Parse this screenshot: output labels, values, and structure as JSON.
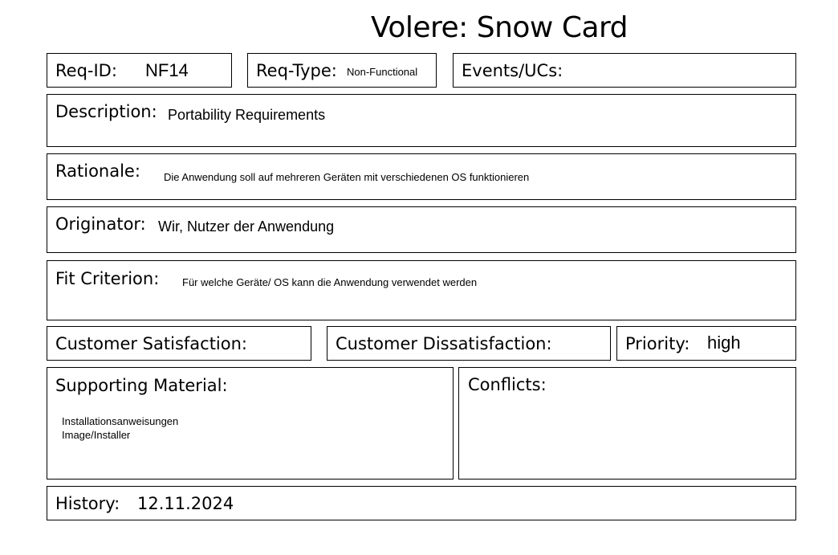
{
  "title": "Volere: Snow Card",
  "req_id": {
    "label": "Req-ID:",
    "value": "NF14"
  },
  "req_type": {
    "label": "Req-Type:",
    "value": "Non-Functional"
  },
  "events": {
    "label": "Events/UCs:",
    "value": ""
  },
  "description": {
    "label": "Description:",
    "value": "Portability Requirements"
  },
  "rationale": {
    "label": "Rationale:",
    "value": "Die Anwendung soll auf mehreren Geräten mit verschiedenen OS funktionieren"
  },
  "originator": {
    "label": "Originator:",
    "value": "Wir, Nutzer der Anwendung"
  },
  "fit_criterion": {
    "label": "Fit Criterion:",
    "value": "Für welche Geräte/ OS kann die Anwendung verwendet werden"
  },
  "customer_satisfaction": {
    "label": "Customer Satisfaction:",
    "value": ""
  },
  "customer_dissatisfaction": {
    "label": "Customer Dissatisfaction:",
    "value": ""
  },
  "priority": {
    "label": "Priority:",
    "value": "high"
  },
  "supporting_material": {
    "label": "Supporting Material:",
    "lines": [
      "Installationsanweisungen",
      "Image/Installer"
    ]
  },
  "conflicts": {
    "label": "Conflicts:",
    "value": ""
  },
  "history": {
    "label": "History:",
    "value": "12.11.2024"
  }
}
